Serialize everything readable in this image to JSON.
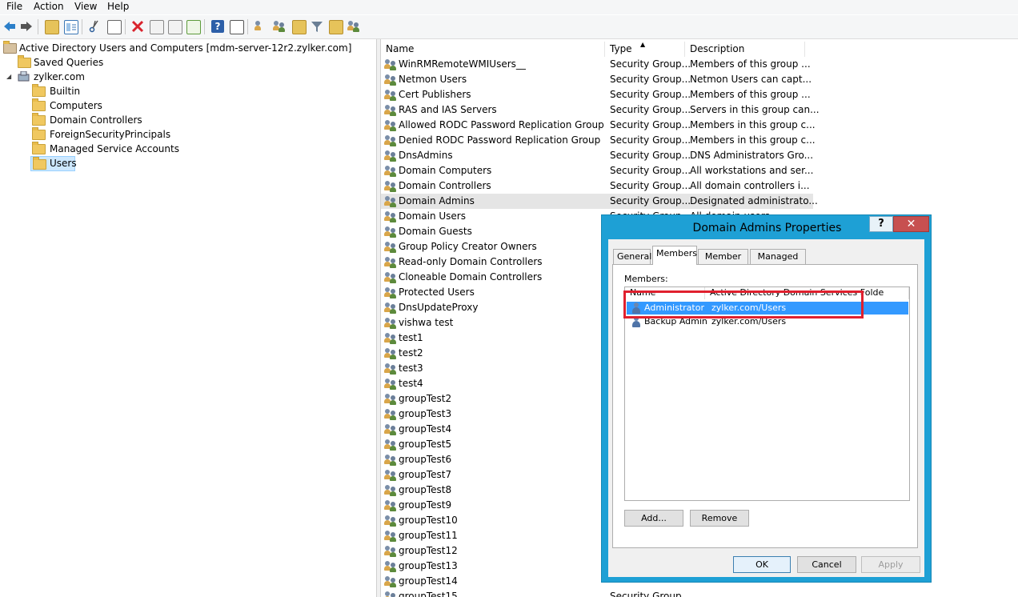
{
  "menu": [
    "File",
    "Action",
    "View",
    "Help"
  ],
  "toolbar_icons": [
    "back-arrow-icon",
    "forward-arrow-icon",
    "up-folder-icon",
    "show-tree-icon",
    "cut-icon",
    "clipboard-icon",
    "delete-icon",
    "properties-icon",
    "refresh-icon",
    "export-list-icon",
    "help-icon",
    "console-icon",
    "new-user-icon",
    "new-group-icon",
    "new-ou-icon",
    "filter-icon",
    "find-icon",
    "add-to-group-icon"
  ],
  "tree": {
    "root": "Active Directory Users and Computers [mdm-server-12r2.zylker.com]",
    "saved_queries": "Saved Queries",
    "domain": "zylker.com",
    "expander": "◢",
    "children": [
      "Builtin",
      "Computers",
      "Domain Controllers",
      "ForeignSecurityPrincipals",
      "Managed Service Accounts",
      "Users"
    ],
    "selected": "Users"
  },
  "list": {
    "columns": [
      "Name",
      "Type",
      "Description"
    ],
    "sort_glyph": "▲",
    "rows": [
      [
        "WinRMRemoteWMIUsers__",
        "Security Group...",
        "Members of this group ..."
      ],
      [
        "Netmon Users",
        "Security Group...",
        "Netmon Users can capt..."
      ],
      [
        "Cert Publishers",
        "Security Group...",
        "Members of this group ..."
      ],
      [
        "RAS and IAS Servers",
        "Security Group...",
        "Servers in this group can..."
      ],
      [
        "Allowed RODC Password Replication Group",
        "Security Group...",
        "Members in this group c..."
      ],
      [
        "Denied RODC Password Replication Group",
        "Security Group...",
        "Members in this group c..."
      ],
      [
        "DnsAdmins",
        "Security Group...",
        "DNS Administrators Gro..."
      ],
      [
        "Domain Computers",
        "Security Group...",
        "All workstations and ser..."
      ],
      [
        "Domain Controllers",
        "Security Group...",
        "All domain controllers i..."
      ],
      [
        "Domain Admins",
        "Security Group...",
        "Designated administrato..."
      ],
      [
        "Domain Users",
        "Security Group...",
        "All domain users"
      ],
      [
        "Domain Guests",
        "",
        ""
      ],
      [
        "Group Policy Creator Owners",
        "",
        ""
      ],
      [
        "Read-only Domain Controllers",
        "",
        ""
      ],
      [
        "Cloneable Domain Controllers",
        "",
        ""
      ],
      [
        "Protected Users",
        "",
        ""
      ],
      [
        "DnsUpdateProxy",
        "",
        ""
      ],
      [
        "vishwa test",
        "",
        ""
      ],
      [
        "test1",
        "",
        ""
      ],
      [
        "test2",
        "",
        ""
      ],
      [
        "test3",
        "",
        ""
      ],
      [
        "test4",
        "",
        ""
      ],
      [
        "groupTest2",
        "",
        ""
      ],
      [
        "groupTest3",
        "",
        ""
      ],
      [
        "groupTest4",
        "",
        ""
      ],
      [
        "groupTest5",
        "",
        ""
      ],
      [
        "groupTest6",
        "",
        ""
      ],
      [
        "groupTest7",
        "",
        ""
      ],
      [
        "groupTest8",
        "",
        ""
      ],
      [
        "groupTest9",
        "",
        ""
      ],
      [
        "groupTest10",
        "",
        ""
      ],
      [
        "groupTest11",
        "",
        ""
      ],
      [
        "groupTest12",
        "",
        ""
      ],
      [
        "groupTest13",
        "",
        ""
      ],
      [
        "groupTest14",
        "",
        ""
      ],
      [
        "groupTest15",
        "Security Group...",
        ""
      ]
    ],
    "selected_row": "Domain Admins"
  },
  "dialog": {
    "title": "Domain Admins Properties",
    "help": "?",
    "close": "✕",
    "tabs": [
      "General",
      "Members",
      "Member Of",
      "Managed By"
    ],
    "active_tab": "Members",
    "members_label": "Members:",
    "columns": [
      "Name",
      "Active Directory Domain Services Folde"
    ],
    "members": [
      {
        "name": "Administrator",
        "folder": "zylker.com/Users"
      },
      {
        "name": "Backup Admin",
        "folder": "zylker.com/Users"
      }
    ],
    "add_label": "Add...",
    "remove_label": "Remove",
    "ok_label": "OK",
    "cancel_label": "Cancel",
    "apply_label": "Apply"
  },
  "colors": {
    "dialog_frame": "#1ea0d5",
    "highlight_box": "#e0202e",
    "selection": "#3399ff"
  }
}
